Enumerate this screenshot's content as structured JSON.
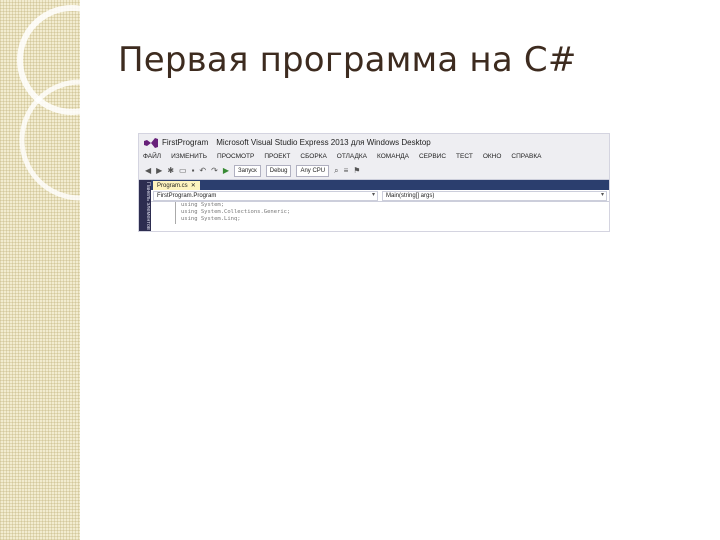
{
  "slide": {
    "title": "Первая программа на C#"
  },
  "window": {
    "project_name": "FirstProgram",
    "title": "Microsoft Visual Studio Express 2013 для Windows Desktop"
  },
  "menu": [
    "ФАЙЛ",
    "ИЗМЕНИТЬ",
    "ПРОСМОТР",
    "ПРОЕКТ",
    "СБОРКА",
    "ОТЛАДКА",
    "КОМАНДА",
    "СЕРВИС",
    "ТЕСТ",
    "ОКНО",
    "СПРАВКА"
  ],
  "toolbar": {
    "start_label": "Запуск",
    "config_value": "Debug",
    "platform_value": "Any CPU"
  },
  "side_panel": {
    "label": "Панель элементов"
  },
  "editor": {
    "tab_label": "Program.cs",
    "class_nav": "FirstProgram.Program",
    "member_nav": "Main(string[] args)",
    "code_lines": [
      "using System;",
      "using System.Collections.Generic;",
      "using System.Linq;"
    ]
  },
  "colors": {
    "title_text": "#3d2b1f",
    "vs_purple": "#68217a",
    "tab_strip": "#2b3e6e",
    "active_tab": "#fdf4bf"
  }
}
